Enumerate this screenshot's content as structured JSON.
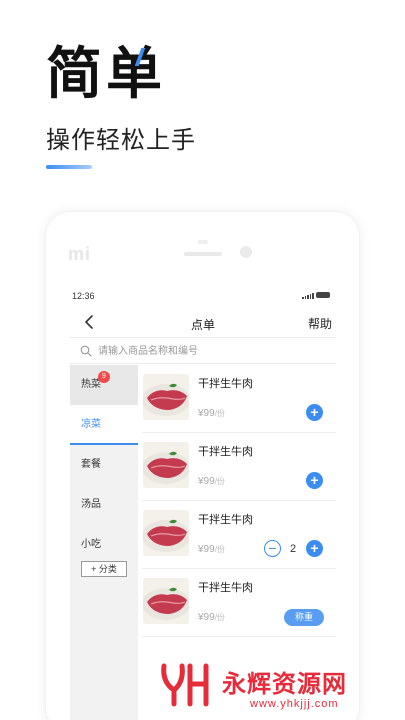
{
  "hero": {
    "title": "简单",
    "subtitle": "操作轻松上手"
  },
  "phone": {
    "logo": "mi"
  },
  "status_bar": {
    "time": "12:36"
  },
  "nav": {
    "title": "点单",
    "help": "帮助"
  },
  "search": {
    "placeholder": "请输入商品名称和编号",
    "value": ""
  },
  "sidebar": {
    "categories": [
      {
        "label": "热菜",
        "badge": "9"
      },
      {
        "label": "凉菜"
      },
      {
        "label": "套餐"
      },
      {
        "label": "汤品"
      },
      {
        "label": "小吃"
      }
    ],
    "add_category": "+ 分类"
  },
  "dishes": [
    {
      "name": "干拌生牛肉",
      "price": "¥99",
      "unit": "/份"
    },
    {
      "name": "干拌生牛肉",
      "price": "¥99",
      "unit": "/份"
    },
    {
      "name": "干拌生牛肉",
      "price": "¥99",
      "unit": "/份",
      "quantity": "2"
    },
    {
      "name": "干拌生牛肉",
      "price": "¥99",
      "unit": "/份",
      "action": "称重"
    }
  ],
  "watermark": {
    "text": "永辉资源网",
    "url": "www.yhkjjj.com"
  },
  "colors": {
    "accent": "#3b8df0",
    "badge": "#f04a4a",
    "watermark": "#e62b3a"
  }
}
